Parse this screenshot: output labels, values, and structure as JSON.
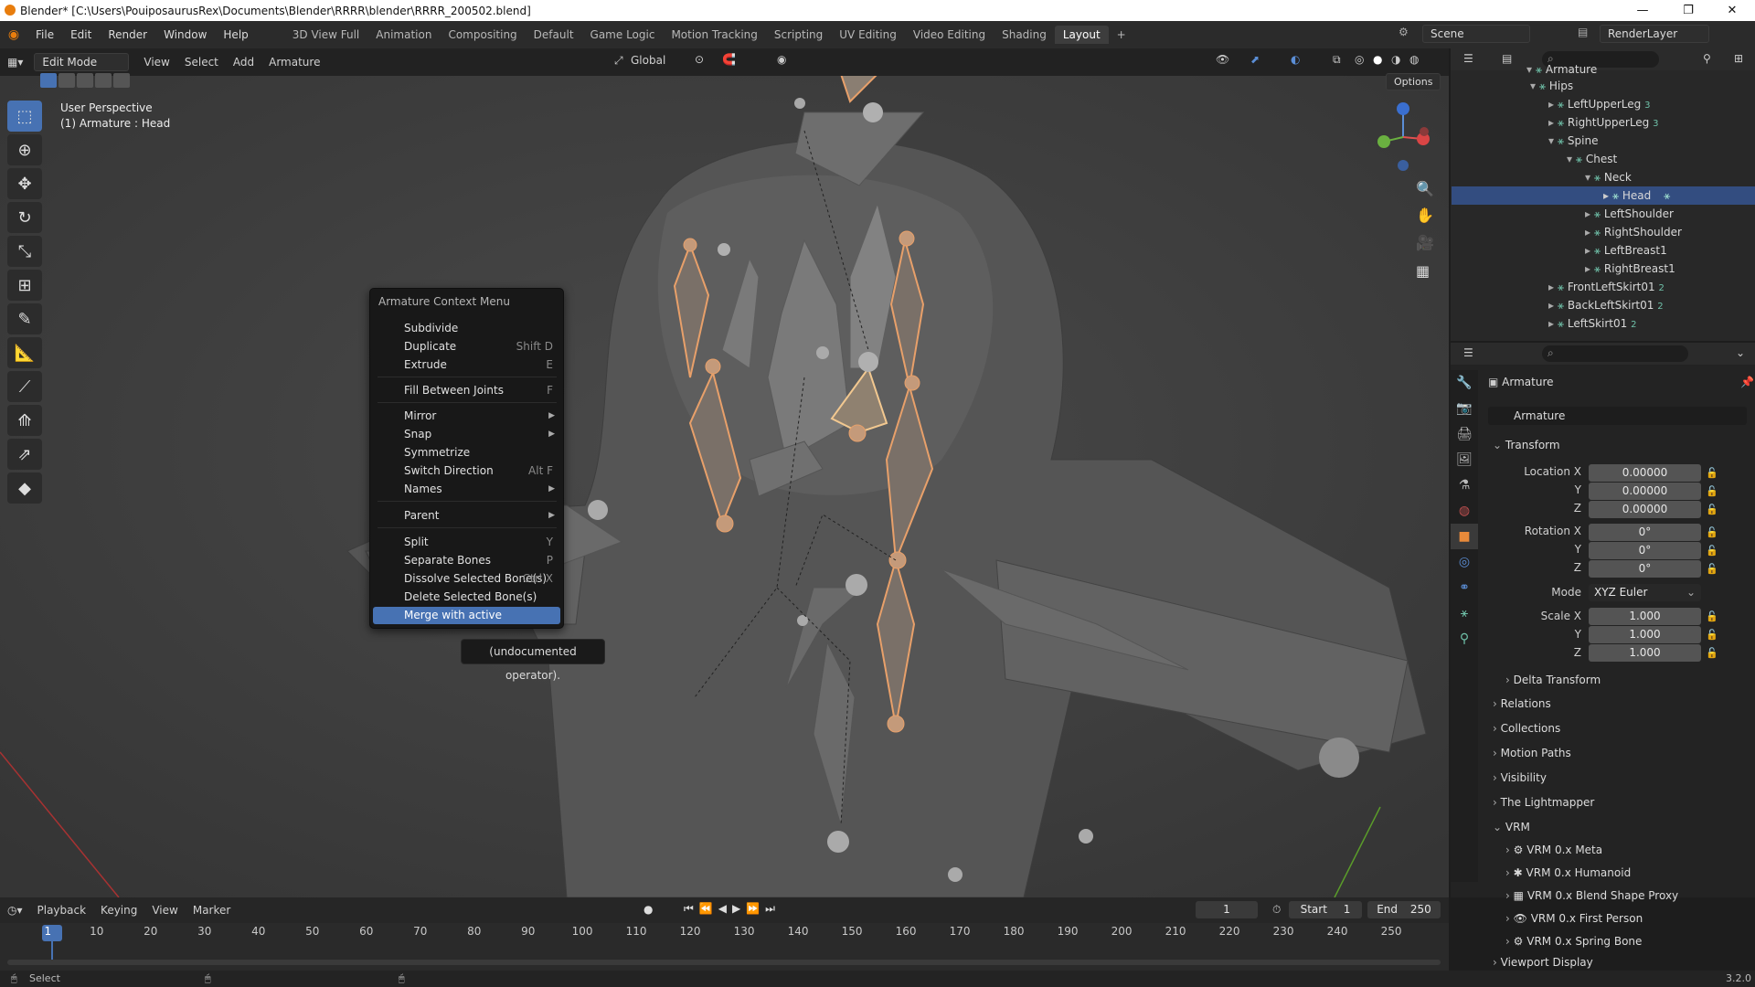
{
  "window": {
    "title": "Blender* [C:\\Users\\PouiposaurusRex\\Documents\\Blender\\RRRR\\blender\\RRRR_200502.blend]",
    "minimize": "—",
    "maximize": "❐",
    "close": "✕"
  },
  "menubar": {
    "items": [
      "File",
      "Edit",
      "Render",
      "Window",
      "Help"
    ],
    "workspaces": [
      "3D View Full",
      "Animation",
      "Compositing",
      "Default",
      "Game Logic",
      "Motion Tracking",
      "Scripting",
      "UV Editing",
      "Video Editing",
      "Shading",
      "Layout"
    ],
    "active_workspace": "Layout",
    "add_tab": "+",
    "scene": "Scene",
    "render_layer": "RenderLayer"
  },
  "viewport_header": {
    "mode": "Edit Mode",
    "menus": [
      "View",
      "Select",
      "Add",
      "Armature"
    ],
    "orientation": "Global",
    "options": "Options"
  },
  "viewport": {
    "view_name": "User Perspective",
    "active_object": "(1) Armature : Head"
  },
  "context_menu": {
    "title": "Armature Context Menu",
    "items": [
      {
        "label": "Subdivide",
        "shortcut": "",
        "submenu": false
      },
      {
        "label": "Duplicate",
        "shortcut": "Shift D",
        "submenu": false
      },
      {
        "label": "Extrude",
        "shortcut": "E",
        "submenu": false
      },
      {
        "label": "Fill Between Joints",
        "shortcut": "F",
        "submenu": false
      },
      {
        "label": "Mirror",
        "shortcut": "",
        "submenu": true
      },
      {
        "label": "Snap",
        "shortcut": "",
        "submenu": true
      },
      {
        "label": "Symmetrize",
        "shortcut": "",
        "submenu": false
      },
      {
        "label": "Switch Direction",
        "shortcut": "Alt F",
        "submenu": false
      },
      {
        "label": "Names",
        "shortcut": "",
        "submenu": true
      },
      {
        "label": "Parent",
        "shortcut": "",
        "submenu": true
      },
      {
        "label": "Split",
        "shortcut": "Y",
        "submenu": false
      },
      {
        "label": "Separate Bones",
        "shortcut": "P",
        "submenu": false
      },
      {
        "label": "Dissolve Selected Bone(s)",
        "shortcut": "Ctrl X",
        "submenu": false
      },
      {
        "label": "Delete Selected Bone(s)",
        "shortcut": "",
        "submenu": false
      },
      {
        "label": "Merge with active",
        "shortcut": "",
        "submenu": false
      }
    ],
    "highlighted": "Merge with active",
    "tooltip": "(undocumented operator)."
  },
  "outliner": {
    "rows": [
      {
        "label": "Armature",
        "depth": 0,
        "expanded": true,
        "badge": ""
      },
      {
        "label": "Hips",
        "depth": 1,
        "expanded": true,
        "badge": ""
      },
      {
        "label": "LeftUpperLeg",
        "depth": 2,
        "expanded": false,
        "badge": "3"
      },
      {
        "label": "RightUpperLeg",
        "depth": 2,
        "expanded": false,
        "badge": "3"
      },
      {
        "label": "Spine",
        "depth": 2,
        "expanded": true,
        "badge": ""
      },
      {
        "label": "Chest",
        "depth": 3,
        "expanded": true,
        "badge": ""
      },
      {
        "label": "Neck",
        "depth": 4,
        "expanded": true,
        "badge": ""
      },
      {
        "label": "Head",
        "depth": 5,
        "expanded": false,
        "badge": ""
      },
      {
        "label": "LeftShoulder",
        "depth": 4,
        "expanded": false,
        "badge": ""
      },
      {
        "label": "RightShoulder",
        "depth": 4,
        "expanded": false,
        "badge": ""
      },
      {
        "label": "LeftBreast1",
        "depth": 4,
        "expanded": false,
        "badge": ""
      },
      {
        "label": "RightBreast1",
        "depth": 4,
        "expanded": false,
        "badge": ""
      },
      {
        "label": "FrontLeftSkirt01",
        "depth": 2,
        "expanded": false,
        "badge": "2"
      },
      {
        "label": "BackLeftSkirt01",
        "depth": 2,
        "expanded": false,
        "badge": "2"
      },
      {
        "label": "LeftSkirt01",
        "depth": 2,
        "expanded": false,
        "badge": "2"
      }
    ],
    "selected": "Head"
  },
  "properties": {
    "object_name": "Armature",
    "data_name": "Armature",
    "transform_title": "Transform",
    "location_label": "Location X",
    "location": [
      "0.00000",
      "0.00000",
      "0.00000"
    ],
    "rotation_label": "Rotation X",
    "rotation": [
      "0°",
      "0°",
      "0°"
    ],
    "mode_label": "Mode",
    "mode": "XYZ Euler",
    "scale_label": "Scale X",
    "scale": [
      "1.000",
      "1.000",
      "1.000"
    ],
    "axis_y": "Y",
    "axis_z": "Z",
    "panels": [
      "Delta Transform",
      "Relations",
      "Collections",
      "Motion Paths",
      "Visibility",
      "The Lightmapper",
      "VRM"
    ],
    "vrm_items": [
      "VRM 0.x Meta",
      "VRM 0.x Humanoid",
      "VRM 0.x Blend Shape Proxy",
      "VRM 0.x First Person",
      "VRM 0.x Spring Bone"
    ],
    "cut_panel": "Viewport Display"
  },
  "timeline": {
    "menus": [
      "Playback",
      "Keying",
      "View",
      "Marker"
    ],
    "current_frame": "1",
    "start_label": "Start",
    "start": "1",
    "end_label": "End",
    "end": "250",
    "ticks": [
      "1",
      "10",
      "20",
      "30",
      "40",
      "50",
      "60",
      "70",
      "80",
      "90",
      "100",
      "110",
      "120",
      "130",
      "140",
      "150",
      "160",
      "170",
      "180",
      "190",
      "200",
      "210",
      "220",
      "230",
      "240",
      "250"
    ]
  },
  "statusbar": {
    "left": "Select",
    "version": "3.2.0"
  },
  "colors": {
    "accent": "#4772b3",
    "bone_selected": "#e8a06a",
    "bone_active": "#f2c890"
  }
}
